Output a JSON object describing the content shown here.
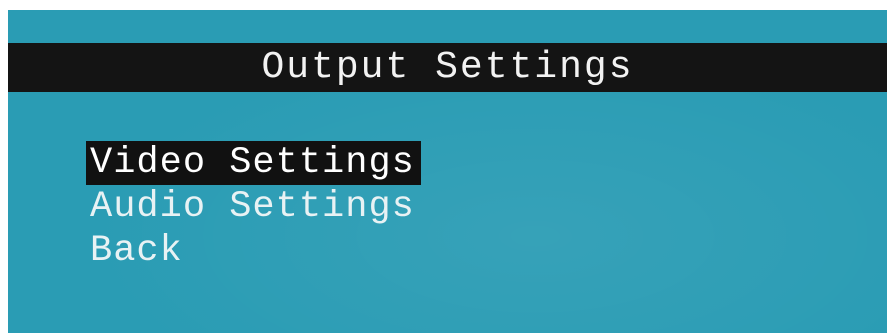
{
  "title": "Output Settings",
  "menu": {
    "items": [
      {
        "label": "Video Settings",
        "selected": true
      },
      {
        "label": "Audio Settings",
        "selected": false
      },
      {
        "label": "Back",
        "selected": false
      }
    ]
  },
  "colors": {
    "background": "#2a9cb4",
    "title_bar": "#141414",
    "text": "#e8f2f4",
    "selection": "#111111"
  }
}
